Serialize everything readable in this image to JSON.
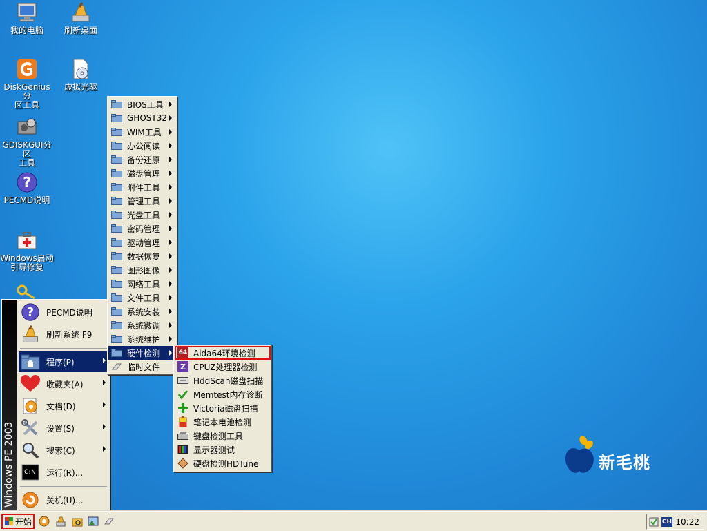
{
  "desktop": {
    "icons": [
      {
        "label": "我的电脑"
      },
      {
        "label": "刷新桌面"
      },
      {
        "label": "DiskGenius分\n区工具"
      },
      {
        "label": "虚拟光驱"
      },
      {
        "label": "GDISKGUI分区\n工具"
      },
      {
        "label": "PECMD说明"
      },
      {
        "label": "Windows启动\n引导修复"
      }
    ]
  },
  "start_menu": {
    "strip_text": "Windows PE 2003",
    "items": [
      {
        "label": "PECMD说明"
      },
      {
        "label": "刷新系统 F9"
      },
      {
        "label": "程序(P)"
      },
      {
        "label": "收藏夹(A)"
      },
      {
        "label": "文档(D)"
      },
      {
        "label": "设置(S)"
      },
      {
        "label": "搜索(C)"
      },
      {
        "label": "运行(R)..."
      },
      {
        "label": "关机(U)..."
      }
    ]
  },
  "programs_menu": {
    "items": [
      {
        "label": "BIOS工具"
      },
      {
        "label": "GHOST32"
      },
      {
        "label": "WIM工具"
      },
      {
        "label": "办公阅读"
      },
      {
        "label": "备份还原"
      },
      {
        "label": "磁盘管理"
      },
      {
        "label": "附件工具"
      },
      {
        "label": "管理工具"
      },
      {
        "label": "光盘工具"
      },
      {
        "label": "密码管理"
      },
      {
        "label": "驱动管理"
      },
      {
        "label": "数据恢复"
      },
      {
        "label": "图形图像"
      },
      {
        "label": "网络工具"
      },
      {
        "label": "文件工具"
      },
      {
        "label": "系统安装"
      },
      {
        "label": "系统微调"
      },
      {
        "label": "系统维护"
      },
      {
        "label": "硬件检测"
      },
      {
        "label": "临时文件"
      }
    ]
  },
  "hardware_menu": {
    "items": [
      {
        "label": "Aida64环境检测",
        "badge": "64"
      },
      {
        "label": "CPUZ处理器检测",
        "badge": "Z"
      },
      {
        "label": "HddScan磁盘扫描"
      },
      {
        "label": "Memtest内存诊断"
      },
      {
        "label": "Victoria磁盘扫描"
      },
      {
        "label": "笔记本电池检测"
      },
      {
        "label": "键盘检测工具"
      },
      {
        "label": "显示器测试"
      },
      {
        "label": "硬盘检测HDTune"
      }
    ]
  },
  "taskbar": {
    "start_label": "开始",
    "tray_lang": "CH",
    "clock": "10:22"
  },
  "brand": {
    "name": "新毛桃"
  },
  "colors": {
    "highlight": "#0a246a",
    "selection_outline": "#e01010",
    "menu_bg": "#ece9d8"
  }
}
